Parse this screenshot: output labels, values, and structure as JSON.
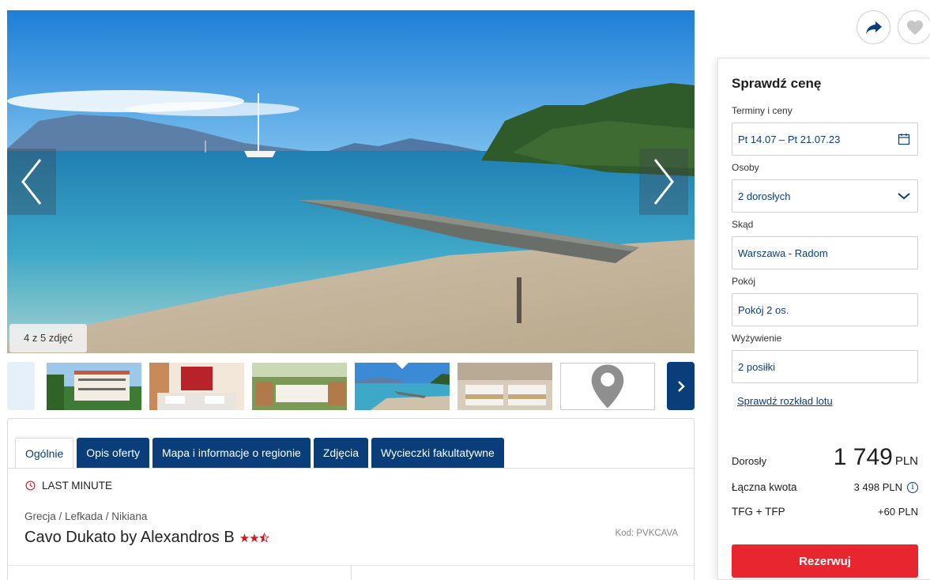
{
  "gallery": {
    "counter": "4 z 5 zdjęć",
    "thumbs": [
      "hotel-building",
      "restaurant-interior",
      "terrace-dining",
      "beach-pier",
      "bedroom",
      "map"
    ]
  },
  "tabs": [
    {
      "label": "Ogólnie"
    },
    {
      "label": "Opis oferty"
    },
    {
      "label": "Mapa i informacje o regionie"
    },
    {
      "label": "Zdjęcia"
    },
    {
      "label": "Wycieczki fakultatywne"
    }
  ],
  "offer": {
    "badge": "LAST MINUTE",
    "breadcrumb": "Grecja / Lefkada / Nikiana",
    "hotel_name": "Cavo Dukato by Alexandros B",
    "stars_rating": 3.5,
    "code": "Kod: PVKCAVA"
  },
  "panel": {
    "title": "Sprawdź cenę",
    "dates_label": "Terminy i ceny",
    "dates_value": "Pt 14.07 – Pt 21.07.23",
    "persons_label": "Osoby",
    "persons_value": "2 dorosłych",
    "from_label": "Skąd",
    "from_value": "Warszawa - Radom",
    "room_label": "Pokój",
    "room_value": "Pokój 2 os.",
    "board_label": "Wyżywienie",
    "board_value": "2 posiłki",
    "flight_link": "Sprawdź rozkład lotu",
    "adult_label": "Dorosły",
    "adult_price": "1 749",
    "currency": "PLN",
    "total_label": "Łączna kwota",
    "total_value": "3 498 PLN",
    "fee_label": "TFG + TFP",
    "fee_value": "+60 PLN",
    "reserve_label": "Rezerwuj"
  },
  "colors": {
    "brand_navy": "#0a3e7a",
    "cta_red": "#e8262f",
    "star_red": "#d6151c"
  }
}
